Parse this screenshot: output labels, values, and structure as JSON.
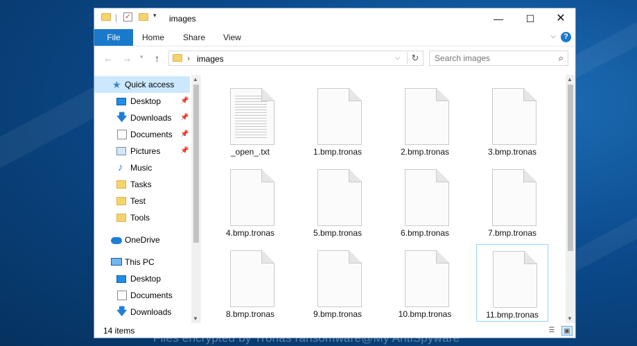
{
  "window": {
    "title": "images"
  },
  "ribbon": {
    "tabs": [
      "File",
      "Home",
      "Share",
      "View"
    ],
    "help_label": "?"
  },
  "address": {
    "path": "images"
  },
  "search": {
    "placeholder": "Search images"
  },
  "nav": {
    "items": [
      {
        "label": "Quick access",
        "icon": "star-icon",
        "pinned": false
      },
      {
        "label": "Desktop",
        "icon": "desktop-icon",
        "pinned": true
      },
      {
        "label": "Downloads",
        "icon": "download-icon",
        "pinned": true
      },
      {
        "label": "Documents",
        "icon": "documents-icon",
        "pinned": true
      },
      {
        "label": "Pictures",
        "icon": "pictures-icon",
        "pinned": true
      },
      {
        "label": "Music",
        "icon": "music-icon",
        "pinned": false
      },
      {
        "label": "Tasks",
        "icon": "folder-icon",
        "pinned": false
      },
      {
        "label": "Test",
        "icon": "folder-icon",
        "pinned": false
      },
      {
        "label": "Tools",
        "icon": "folder-icon",
        "pinned": false
      },
      {
        "label": "OneDrive",
        "icon": "onedrive-icon",
        "pinned": false
      },
      {
        "label": "This PC",
        "icon": "this-pc-icon",
        "pinned": false
      },
      {
        "label": "Desktop",
        "icon": "desktop-icon",
        "pinned": false
      },
      {
        "label": "Documents",
        "icon": "documents-icon",
        "pinned": false
      },
      {
        "label": "Downloads",
        "icon": "download-icon",
        "pinned": false
      }
    ]
  },
  "files": [
    {
      "name": "_open_.txt",
      "type": "text"
    },
    {
      "name": "1.bmp.tronas",
      "type": "blank"
    },
    {
      "name": "2.bmp.tronas",
      "type": "blank"
    },
    {
      "name": "3.bmp.tronas",
      "type": "blank"
    },
    {
      "name": "4.bmp.tronas",
      "type": "blank"
    },
    {
      "name": "5.bmp.tronas",
      "type": "blank"
    },
    {
      "name": "6.bmp.tronas",
      "type": "blank"
    },
    {
      "name": "7.bmp.tronas",
      "type": "blank"
    },
    {
      "name": "8.bmp.tronas",
      "type": "blank"
    },
    {
      "name": "9.bmp.tronas",
      "type": "blank"
    },
    {
      "name": "10.bmp.tronas",
      "type": "blank"
    },
    {
      "name": "11.bmp.tronas",
      "type": "blank",
      "selected": true
    }
  ],
  "status": {
    "item_count": "14 items"
  },
  "watermark": "Files encrypted by Tronas ransomware@My AntiSpyware"
}
